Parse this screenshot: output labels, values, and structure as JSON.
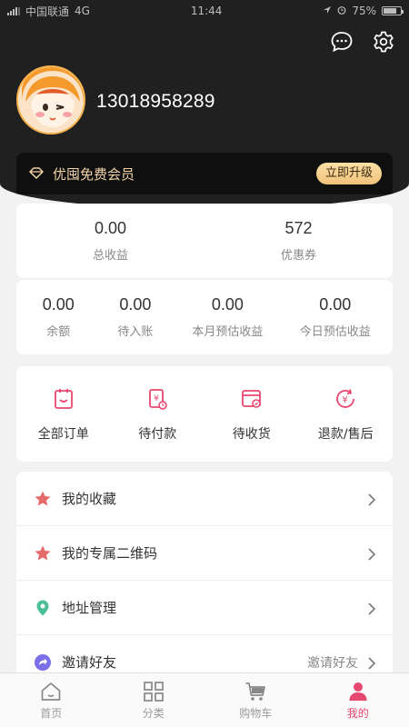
{
  "status_bar": {
    "carrier": "中国联通",
    "network": "4G",
    "time": "11:44",
    "battery": "75%",
    "battery_level": 0.75
  },
  "user": {
    "phone": "13018958289"
  },
  "member": {
    "label": "优囤免费会员",
    "upgrade_label": "立即升级"
  },
  "stats_top": [
    {
      "value": "0.00",
      "label": "总收益"
    },
    {
      "value": "572",
      "label": "优惠券"
    }
  ],
  "stats_bottom": [
    {
      "value": "0.00",
      "label": "余额"
    },
    {
      "value": "0.00",
      "label": "待入账"
    },
    {
      "value": "0.00",
      "label": "本月预估收益"
    },
    {
      "value": "0.00",
      "label": "今日预估收益"
    }
  ],
  "orders": [
    {
      "label": "全部订单",
      "icon": "order-list-icon"
    },
    {
      "label": "待付款",
      "icon": "payment-pending-icon"
    },
    {
      "label": "待收货",
      "icon": "delivery-pending-icon"
    },
    {
      "label": "退款/售后",
      "icon": "refund-icon"
    }
  ],
  "menu": [
    {
      "label": "我的收藏",
      "icon": "star-icon",
      "extra": ""
    },
    {
      "label": "我的专属二维码",
      "icon": "star-icon",
      "extra": ""
    },
    {
      "label": "地址管理",
      "icon": "location-pin-icon",
      "extra": ""
    },
    {
      "label": "邀请好友",
      "icon": "share-icon",
      "extra": "邀请好友"
    }
  ],
  "tabs": [
    {
      "label": "首页",
      "icon": "home-icon"
    },
    {
      "label": "分类",
      "icon": "category-grid-icon"
    },
    {
      "label": "购物车",
      "icon": "cart-icon"
    },
    {
      "label": "我的",
      "icon": "profile-icon"
    }
  ],
  "colors": {
    "accent": "#e8476f",
    "header_bg": "#202020",
    "gold": "#f2d4a8"
  }
}
